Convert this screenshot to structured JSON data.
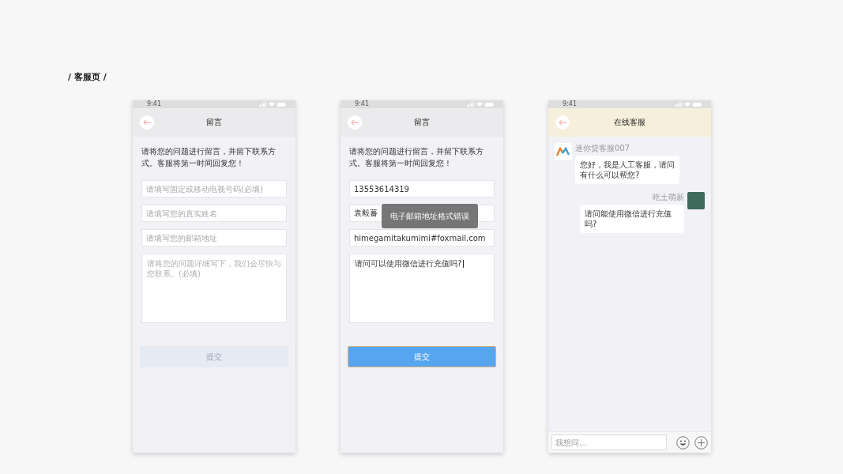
{
  "section_title": "/ 客服页 /",
  "screens": [
    {
      "kind": "form",
      "status_time": "9:41",
      "title": "留言",
      "intro": "请将您的问题进行留言，并留下联系方式。客服将第一时间回复您！",
      "fields": [
        {
          "placeholder": "请填写固定或移动电视号码(必填)"
        },
        {
          "placeholder": "请填写您的真实姓名"
        },
        {
          "placeholder": "请填写您的邮箱地址"
        }
      ],
      "message": {
        "placeholder": "请将您的问题详细写下，我们会尽快与您联系。(必填)",
        "focused": false
      },
      "submit": {
        "label": "提交",
        "disabled": true
      }
    },
    {
      "kind": "form",
      "status_time": "9:41",
      "title": "留言",
      "intro": "请将您的问题进行留言，并留下联系方式。客服将第一时间回复您！",
      "fields": [
        {
          "value": "13553614319"
        },
        {
          "value": "袁毅蕃"
        },
        {
          "value": "himegamitakumimi#foxmail.com"
        }
      ],
      "message": {
        "value": "请问可以使用微信进行充值吗?",
        "focused": true
      },
      "submit": {
        "label": "提交",
        "disabled": false
      },
      "toast": "电子邮箱地址格式错误"
    },
    {
      "kind": "chat",
      "status_time": "9:41",
      "title": "在线客服",
      "messages": [
        {
          "kind": "incoming",
          "sender": "迷你贷客服007",
          "text": "您好，我是人工客服，请问有什么可以帮您?"
        },
        {
          "kind": "outgoing",
          "sender": "吃土萌新",
          "text": "请问能使用微信进行充值吗?"
        }
      ],
      "input": {
        "placeholder": "我想问..."
      }
    }
  ]
}
